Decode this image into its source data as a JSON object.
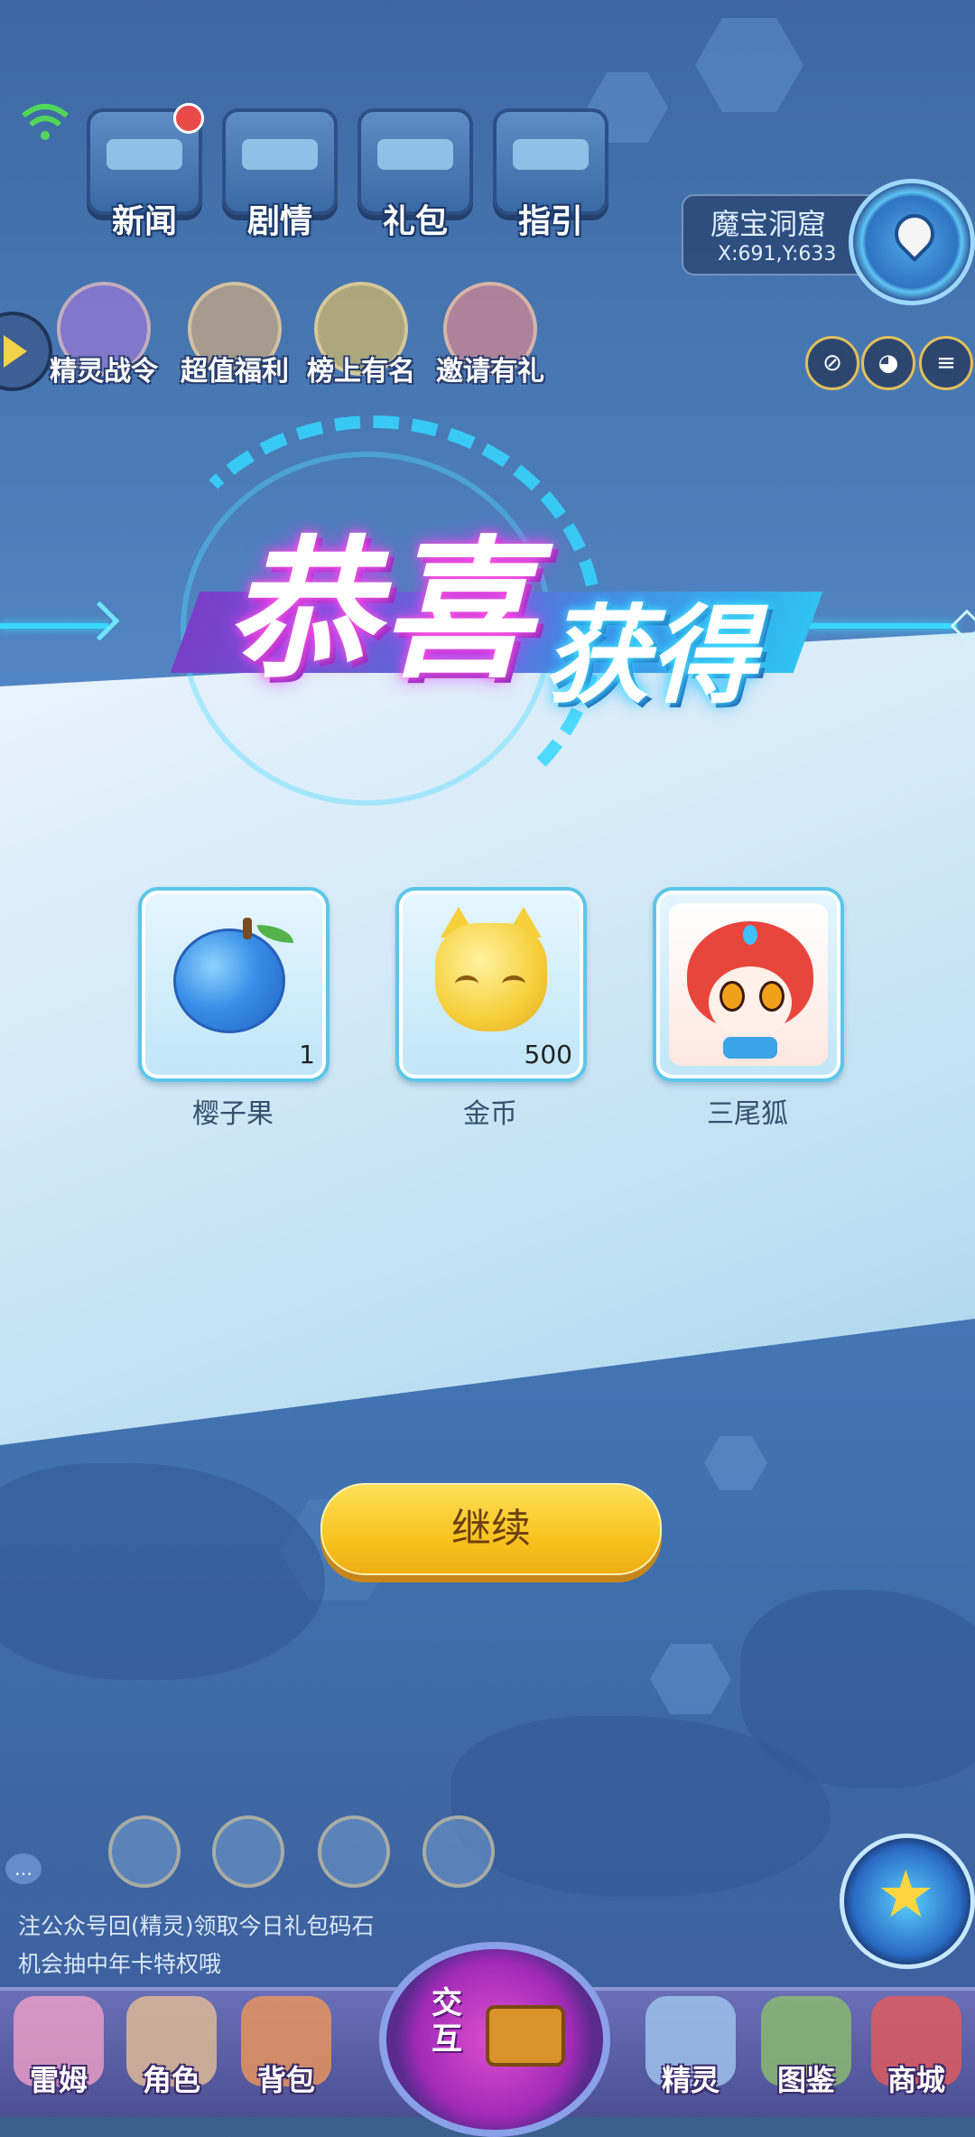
{
  "hud": {
    "top_buttons": [
      {
        "label": "新闻",
        "icon": "tv-news-icon"
      },
      {
        "label": "剧情",
        "icon": "story-icon"
      },
      {
        "label": "礼包",
        "icon": "gift-chest-icon"
      },
      {
        "label": "指引",
        "icon": "guide-icon"
      }
    ],
    "location": {
      "name": "魔宝洞窟",
      "coords": "X:691,Y:633"
    },
    "activities": [
      {
        "label": "精灵战令"
      },
      {
        "label": "超值福利"
      },
      {
        "label": "榜上有名"
      },
      {
        "label": "邀请有礼"
      }
    ],
    "right_icons": [
      "no-entry-icon",
      "pet-face-icon",
      "menu-list-icon"
    ]
  },
  "reward": {
    "title_main": "恭喜",
    "title_sub": "获得",
    "items": [
      {
        "name": "樱子果",
        "qty": "1",
        "icon": "blue-fruit-icon"
      },
      {
        "name": "金币",
        "qty": "500",
        "icon": "gold-coin-cat-icon"
      },
      {
        "name": "三尾狐",
        "qty": "",
        "icon": "three-tail-fox-avatar"
      }
    ],
    "continue_label": "继续"
  },
  "chat": {
    "line1": "注公众号回(精灵)领取今日礼包码石",
    "line2": "机会抽中年卡特权哦"
  },
  "bottom_nav": {
    "items": [
      {
        "label": "雷姆"
      },
      {
        "label": "角色"
      },
      {
        "label": "背包"
      },
      {
        "label": "精灵"
      },
      {
        "label": "图鉴"
      },
      {
        "label": "商城"
      }
    ],
    "center_label": "交互"
  },
  "colors": {
    "accent_cyan": "#38d9ff",
    "button_yellow": "#f9c41f",
    "title_pink": "#ff59d8"
  }
}
